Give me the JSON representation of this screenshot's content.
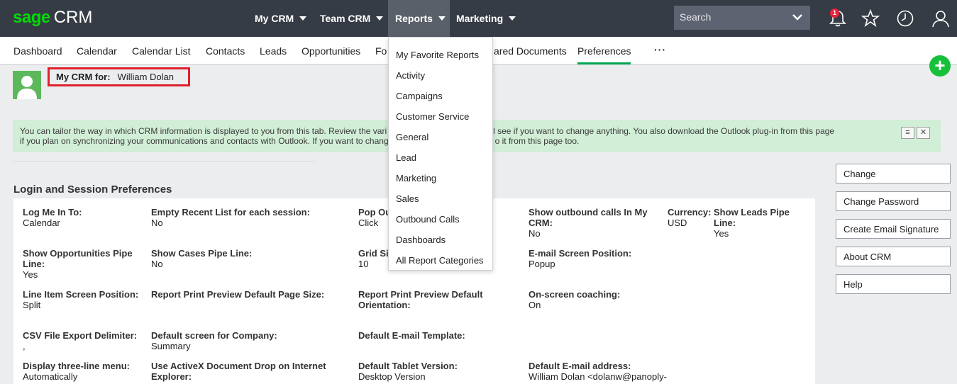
{
  "brand": {
    "sage": "sage",
    "crm": "CRM"
  },
  "topnav": {
    "items": [
      {
        "label": "My CRM"
      },
      {
        "label": "Team CRM"
      },
      {
        "label": "Reports"
      },
      {
        "label": "Marketing"
      }
    ],
    "active": "Reports"
  },
  "search": {
    "placeholder": "Search"
  },
  "notifications": {
    "count": "1"
  },
  "subnav": {
    "items": [
      "Dashboard",
      "Calendar",
      "Calendar List",
      "Contacts",
      "Leads",
      "Opportunities",
      "Fo",
      "ared Documents",
      "Preferences"
    ],
    "more": "···",
    "active": "Preferences"
  },
  "user": {
    "label": "My CRM for:",
    "name": "William Dolan"
  },
  "info": {
    "line1": "You can tailor the way in which CRM information is displayed to you from this tab. Review the vari",
    "line1b": "l see if you want to change anything. You also download the Outlook plug-in from this page",
    "line2": "if you plan on synchronizing your communications and contacts with Outlook. If you want to chang",
    "line2b": "o it from this page too."
  },
  "section": {
    "title": "Login and Session Preferences"
  },
  "fields": {
    "login": {
      "k": "Log Me In To:",
      "v": "Calendar"
    },
    "empty_recent": {
      "k": "Empty Recent List for each session:",
      "v": "No"
    },
    "popup": {
      "k": "Pop Ou",
      "v": "Click"
    },
    "outbound": {
      "k": "Show outbound calls In My CRM:",
      "v": "No"
    },
    "currency": {
      "k": "Currency:",
      "v": "USD"
    },
    "leads_pipe": {
      "k": "Show Leads Pipe Line:",
      "v": "Yes"
    },
    "opp_pipe": {
      "k": "Show Opportunities Pipe Line:",
      "v": "Yes"
    },
    "cases_pipe": {
      "k": "Show Cases Pipe Line:",
      "v": "No"
    },
    "grid": {
      "k": "Grid Si",
      "v": "10"
    },
    "email_pos": {
      "k": "E-mail Screen Position:",
      "v": "Popup"
    },
    "line_item": {
      "k": "Line Item Screen Position:",
      "v": "Split"
    },
    "print_size": {
      "k": "Report Print Preview Default Page Size:",
      "v": ""
    },
    "print_orient": {
      "k": "Report Print Preview Default Orientation:",
      "v": ""
    },
    "coaching": {
      "k": "On-screen coaching:",
      "v": "On"
    },
    "csv": {
      "k": "CSV File Export Delimiter:",
      "v": ","
    },
    "company_screen": {
      "k": "Default screen for Company:",
      "v": "Summary"
    },
    "email_template": {
      "k": "Default E-mail Template:",
      "v": ""
    },
    "three_line": {
      "k": "Display three-line menu:",
      "v": "Automatically"
    },
    "activex": {
      "k": "Use ActiveX Document Drop on Internet Explorer:",
      "v": ""
    },
    "tablet": {
      "k": "Default Tablet Version:",
      "v": "Desktop Version"
    },
    "email_addr": {
      "k": "Default E-mail address:",
      "v": "William Dolan <dolanw@panoply-"
    }
  },
  "actions": [
    "Change",
    "Change Password",
    "Create Email Signature",
    "About CRM",
    "Help"
  ],
  "reports_menu": [
    "My Favorite Reports",
    "Activity",
    "Campaigns",
    "Customer Service",
    "General",
    "Lead",
    "Marketing",
    "Sales",
    "Outbound Calls",
    "Dashboards",
    "All Report Categories"
  ],
  "colors": {
    "topbar": "#363c45",
    "brand_green": "#00dc06",
    "accent_green": "#00a651",
    "info_bg": "#d1eed6",
    "highlight_red": "#e0202a"
  },
  "icons": [
    "bell-icon",
    "star-icon",
    "clock-icon",
    "user-icon",
    "chevron-down-icon",
    "plus-icon"
  ]
}
